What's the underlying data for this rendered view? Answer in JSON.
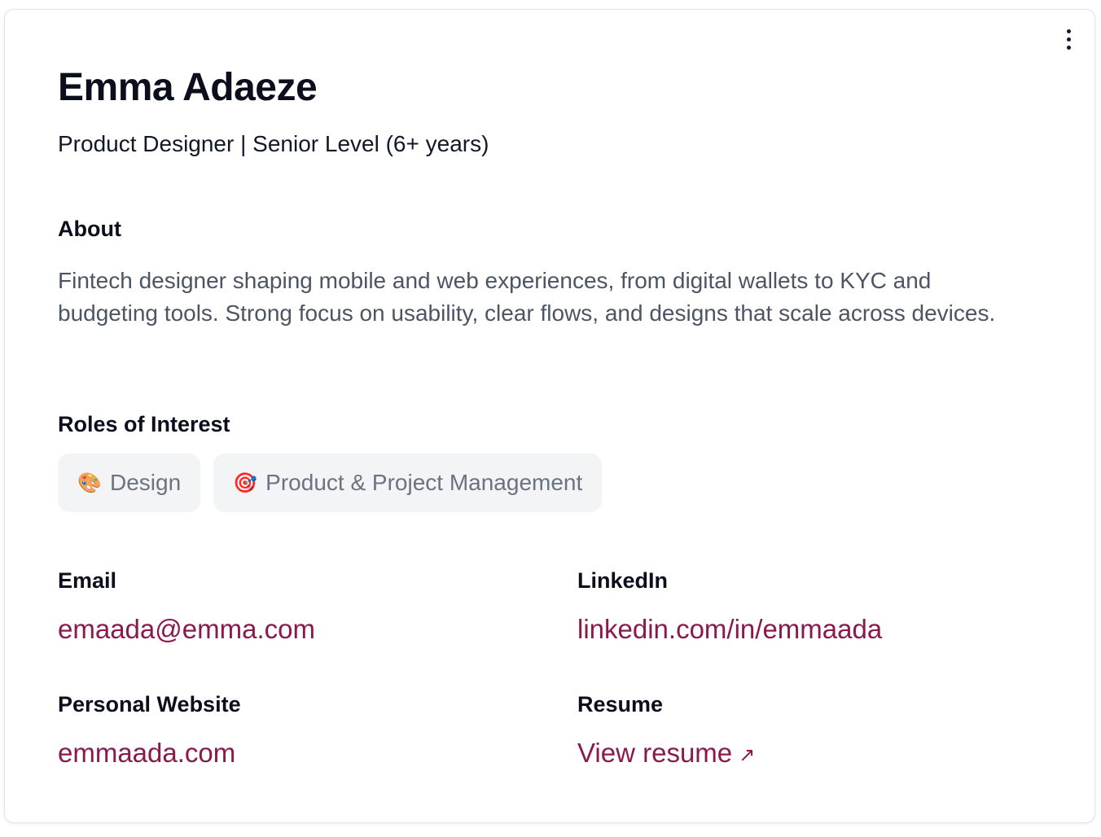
{
  "profile": {
    "name": "Emma Adaeze",
    "headline": "Product Designer | Senior Level (6+ years)"
  },
  "menu": {
    "icon": "more-vertical-icon"
  },
  "about": {
    "label": "About",
    "text": "Fintech designer shaping mobile and web experiences, from digital wallets to KYC and budgeting tools. Strong focus on usability, clear flows, and designs that scale across devices."
  },
  "roles": {
    "label": "Roles of Interest",
    "items": [
      {
        "emoji": "🎨",
        "label": "Design"
      },
      {
        "emoji": "🎯",
        "label": "Product & Project Management"
      }
    ]
  },
  "contact": {
    "email_label": "Email",
    "email": "emaada@emma.com",
    "linkedin_label": "LinkedIn",
    "linkedin": "linkedin.com/in/emmaada",
    "website_label": "Personal Website",
    "website": "emmaada.com",
    "resume_label": "Resume",
    "resume_link": "View resume",
    "resume_icon": "arrow-up-right-icon"
  },
  "colors": {
    "link": "#8a1a4e",
    "chip_bg": "#f3f4f6"
  }
}
